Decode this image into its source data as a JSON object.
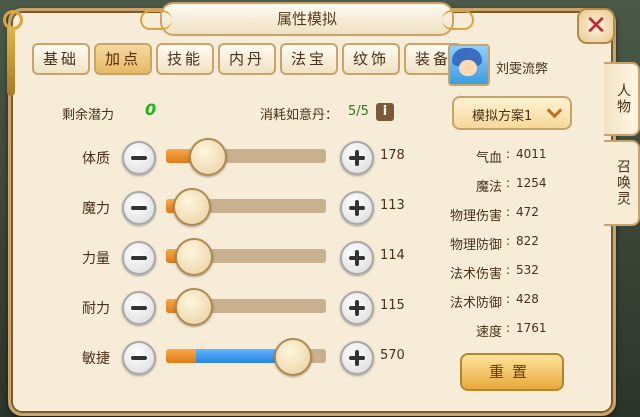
{
  "window": {
    "title": "属性模拟",
    "close": "✕"
  },
  "tabs": [
    "基础",
    "加点",
    "技能",
    "内丹",
    "法宝",
    "纹饰",
    "装备"
  ],
  "active_tab": "加点",
  "potential": {
    "label": "剩余潜力",
    "value": "0"
  },
  "cost": {
    "label": "消耗如意丹：",
    "value": "5/5",
    "info_icon": "i"
  },
  "attributes": [
    {
      "label": "体质",
      "value": "178",
      "base_fraction": 0.25,
      "alloc_fraction": 0.0
    },
    {
      "label": "魔力",
      "value": "113",
      "base_fraction": 0.15,
      "alloc_fraction": 0.0
    },
    {
      "label": "力量",
      "value": "114",
      "base_fraction": 0.16,
      "alloc_fraction": 0.0
    },
    {
      "label": "耐力",
      "value": "115",
      "base_fraction": 0.16,
      "alloc_fraction": 0.0
    },
    {
      "label": "敏捷",
      "value": "570",
      "base_fraction": 0.19,
      "alloc_fraction": 0.59
    }
  ],
  "character": {
    "name": "刘雯流弊"
  },
  "scheme": {
    "label": "模拟方案1"
  },
  "stats": [
    {
      "label": "气血",
      "value": "4011"
    },
    {
      "label": "魔法",
      "value": "1254"
    },
    {
      "label": "物理伤害",
      "value": "472"
    },
    {
      "label": "物理防御",
      "value": "822"
    },
    {
      "label": "法术伤害",
      "value": "532"
    },
    {
      "label": "法术防御",
      "value": "428"
    },
    {
      "label": "速度",
      "value": "1761"
    }
  ],
  "reset_label": "重置",
  "side_tabs": [
    "人物",
    "召唤灵"
  ],
  "colors": {
    "base_fill": "#de7a18",
    "alloc_fill": "#2884e0",
    "potential": "#1fb31f"
  }
}
